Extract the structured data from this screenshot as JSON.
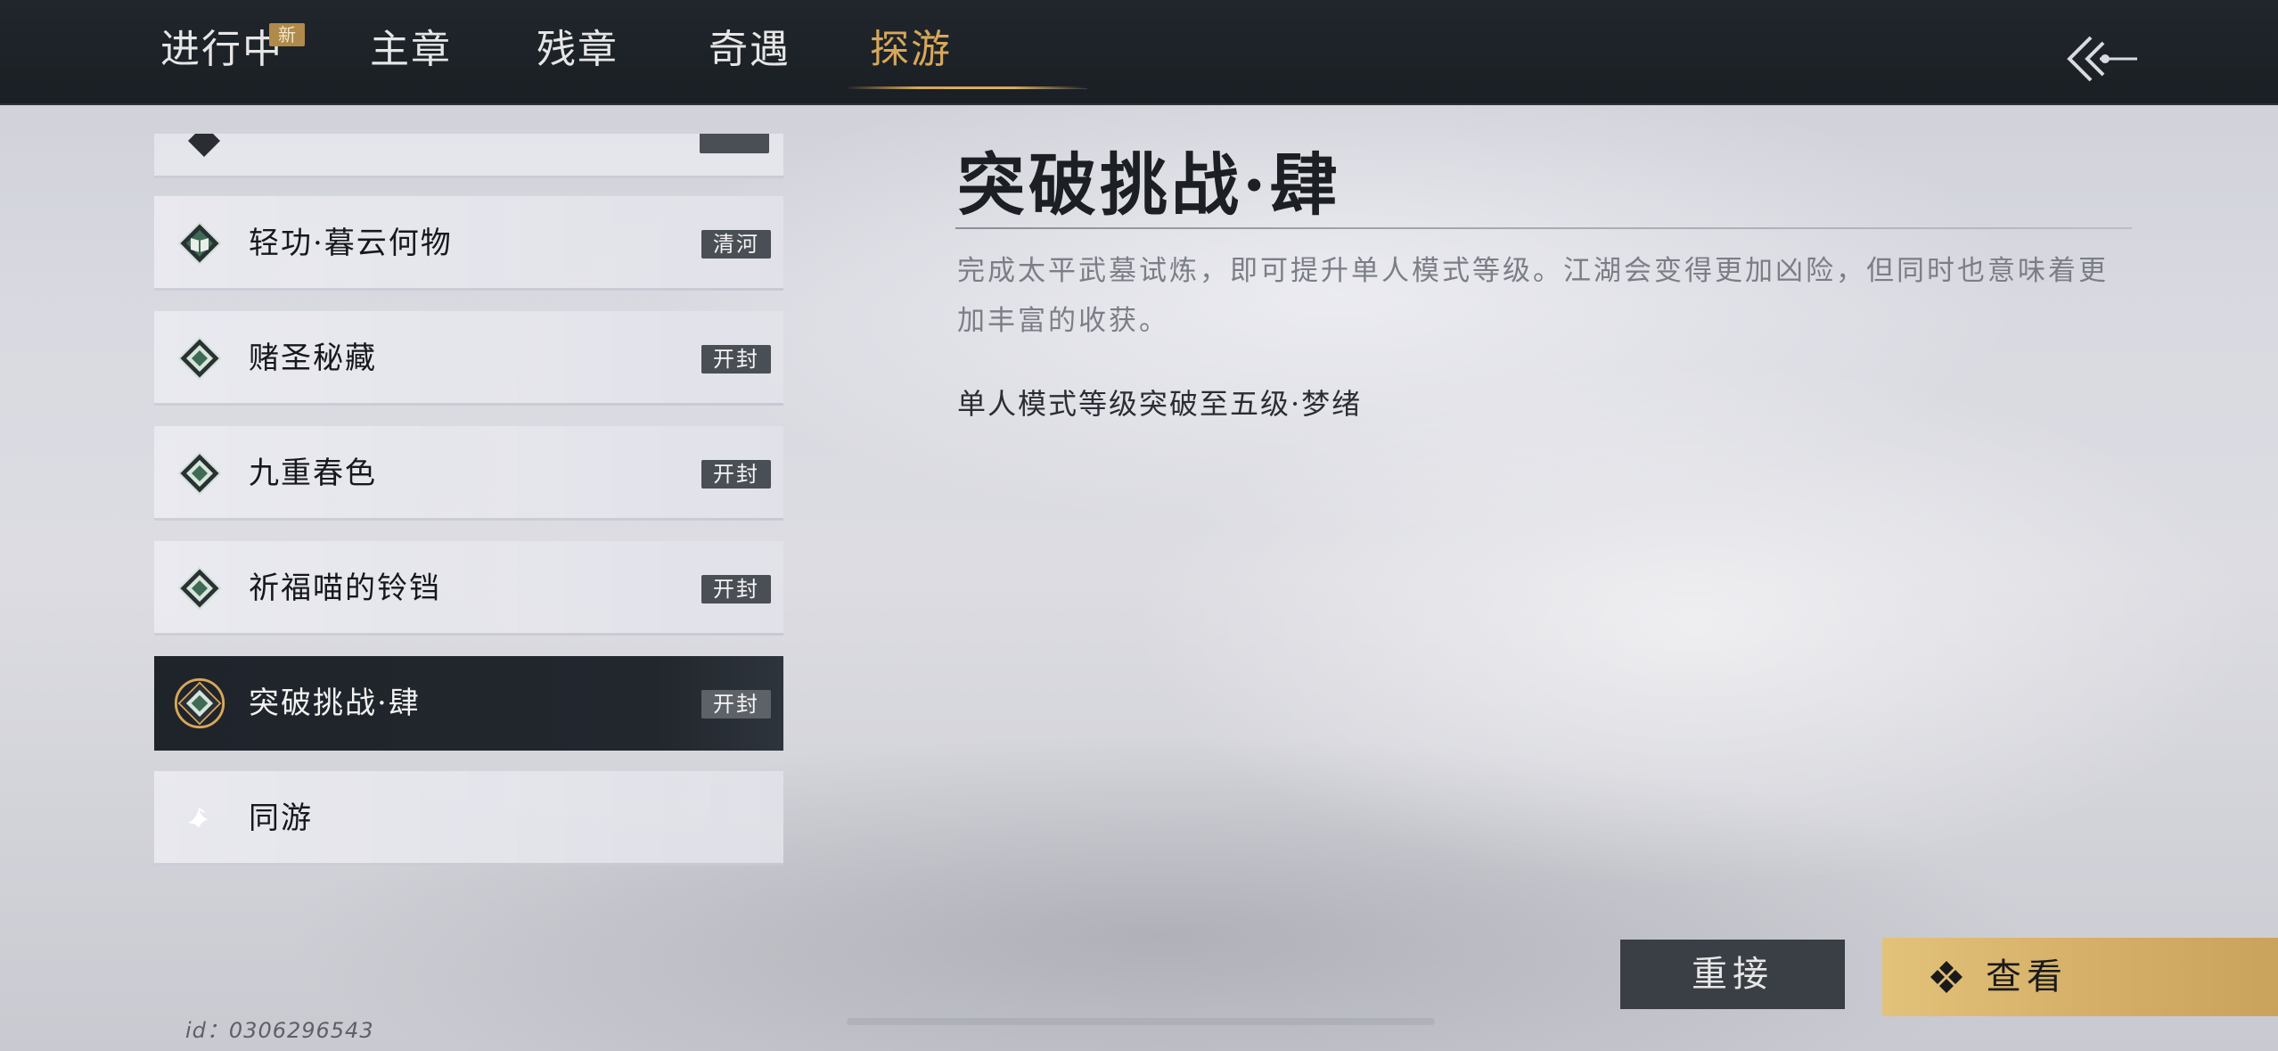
{
  "nav": {
    "tabs": [
      {
        "label": "进行中",
        "badge": "新"
      },
      {
        "label": "主章"
      },
      {
        "label": "残章"
      },
      {
        "label": "奇遇"
      },
      {
        "label": "探游",
        "active": true
      }
    ],
    "back_icon": "back-arrow-icon"
  },
  "list": {
    "items": [
      {
        "label": "轻功·暮云何物",
        "tag": "清河",
        "icon": "book-diamond-icon"
      },
      {
        "label": "赌圣秘藏",
        "tag": "开封",
        "icon": "diamond-emblem-icon"
      },
      {
        "label": "九重春色",
        "tag": "开封",
        "icon": "diamond-emblem-icon"
      },
      {
        "label": "祈福喵的铃铛",
        "tag": "开封",
        "icon": "diamond-emblem-icon"
      },
      {
        "label": "突破挑战·肆",
        "tag": "开封",
        "icon": "diamond-emblem-icon",
        "selected": true
      },
      {
        "label": "同游",
        "icon": "bird-icon"
      }
    ]
  },
  "detail": {
    "title": "突破挑战·肆",
    "description": "完成太平武墓试炼，即可提升单人模式等级。江湖会变得更加凶险，但同时也意味着更加丰富的收获。",
    "subtitle": "单人模式等级突破至五级·梦绪"
  },
  "actions": {
    "reconnect_label": "重接",
    "view_label": "查看",
    "view_icon": "diamond-cluster-icon"
  },
  "footer": {
    "player_id": "id：0306296543"
  },
  "colors": {
    "accent": "#d7a85a",
    "topbar": "#1d2227",
    "selected_item": "#22272e",
    "view_button": "#d6b068"
  }
}
